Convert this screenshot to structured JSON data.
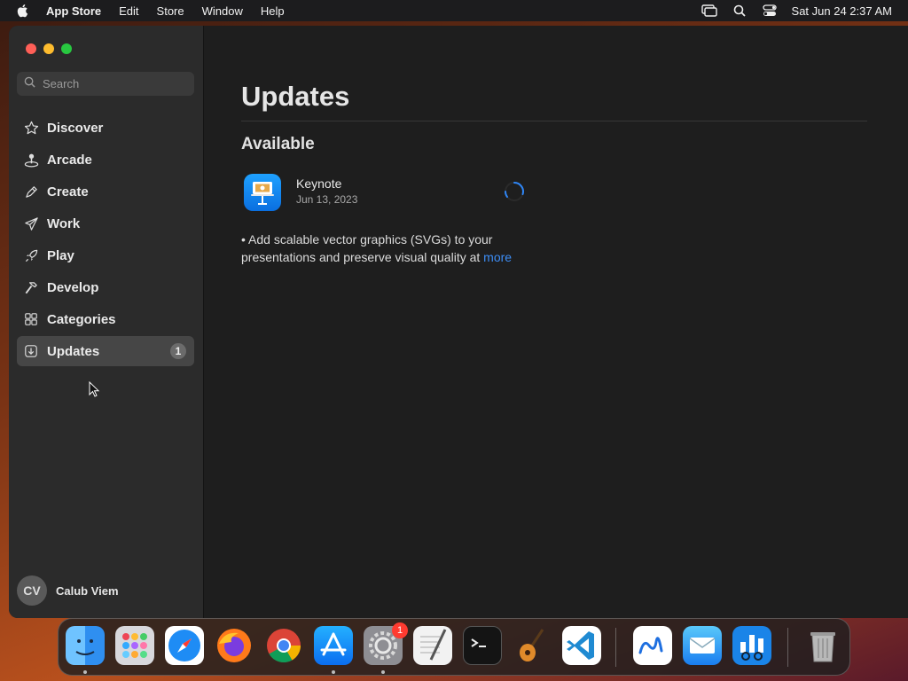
{
  "menubar": {
    "app_name": "App Store",
    "menus": [
      "Edit",
      "Store",
      "Window",
      "Help"
    ],
    "clock": "Sat Jun 24  2:37 AM",
    "icons": [
      "apple-icon",
      "screen-mirroring-icon",
      "spotlight-search-icon",
      "control-center-icon"
    ]
  },
  "sidebar": {
    "search_placeholder": "Search",
    "items": [
      {
        "label": "Discover",
        "icon": "star-icon"
      },
      {
        "label": "Arcade",
        "icon": "joystick-icon"
      },
      {
        "label": "Create",
        "icon": "brush-icon"
      },
      {
        "label": "Work",
        "icon": "paper-plane-icon"
      },
      {
        "label": "Play",
        "icon": "rocket-icon"
      },
      {
        "label": "Develop",
        "icon": "hammer-icon"
      },
      {
        "label": "Categories",
        "icon": "grid-icon"
      },
      {
        "label": "Updates",
        "icon": "download-icon",
        "badge": "1",
        "selected": true
      }
    ],
    "user": {
      "initials": "CV",
      "name": "Calub Viem"
    }
  },
  "main": {
    "title": "Updates",
    "section": "Available",
    "app": {
      "name": "Keynote",
      "date": "Jun 13, 2023",
      "status": "downloading",
      "notes": "• Add scalable vector graphics (SVGs) to your presentations and preserve visual quality at",
      "more": "more"
    }
  },
  "dock": {
    "apps": [
      "Finder",
      "Launchpad",
      "Safari",
      "Firefox",
      "Chrome",
      "App Store",
      "System Settings",
      "TextEdit",
      "Terminal",
      "GarageBand",
      "Visual Studio Code",
      "Freeform",
      "Mail",
      "Metrics",
      "Trash"
    ],
    "system_settings_badge": "1"
  },
  "colors": {
    "accent": "#3d8df5",
    "close": "#ff5f57",
    "minimize": "#febc2e",
    "zoom": "#28c840"
  }
}
